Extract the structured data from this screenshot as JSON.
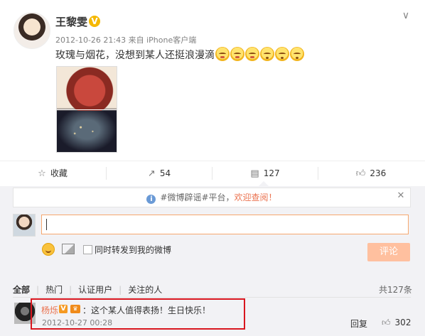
{
  "post": {
    "username": "王黎雯",
    "verified_mark": "V",
    "timestamp": "2012-10-26 21:43",
    "source": "来自 iPhone客户端",
    "text": "玫瑰与烟花，没想到某人还挺浪漫滴"
  },
  "actions": {
    "favorite_label": "收藏",
    "repost_count": "54",
    "comment_count": "127",
    "like_count": "236"
  },
  "comment_panel": {
    "notice_prefix": "#微博辟谣#平台，",
    "notice_link": "欢迎查阅！",
    "input_value": "",
    "repost_checkbox_label": "同时转发到我的微博",
    "submit_label": "评论",
    "filter_tabs": [
      "全部",
      "热门",
      "认证用户",
      "关注的人"
    ],
    "total_comments": "共127条"
  },
  "comment": {
    "username": "杨烁",
    "badge_mark": "V",
    "text": "：这个某人值得表扬！生日快乐！",
    "timestamp": "2012-10-27 00:28",
    "reply_label": "回复",
    "like_count": "302"
  },
  "colors": {
    "accent_orange": "#eb7350",
    "verified_gold": "#f5b800",
    "highlight_red": "#d9161f",
    "submit_disabled": "#ffc09f"
  }
}
